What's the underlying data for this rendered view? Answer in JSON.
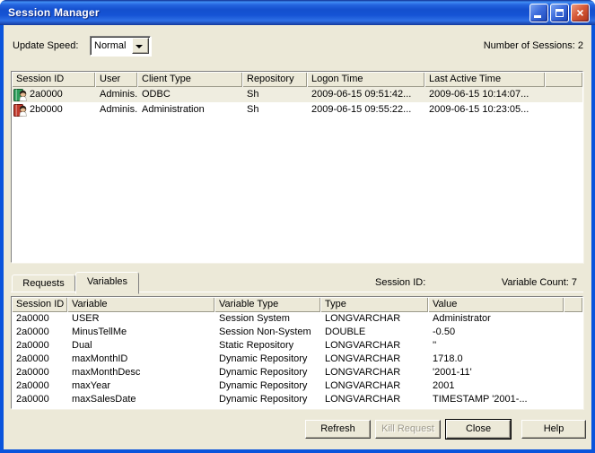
{
  "window": {
    "title": "Session Manager"
  },
  "titlebar": {
    "icons": [
      "minimize-icon",
      "maximize-icon",
      "close-icon"
    ],
    "close_glyph": "×"
  },
  "toolbar": {
    "update_speed_label": "Update Speed:",
    "update_speed_value": "Normal",
    "sessions_count_label": "Number of Sessions: 2"
  },
  "sessions_table": {
    "columns": [
      "Session ID",
      "User",
      "Client Type",
      "Repository",
      "Logon Time",
      "Last Active Time"
    ],
    "rows": [
      {
        "icon": "session-green-icon",
        "session_id": "2a0000",
        "user": "Adminis...",
        "client_type": "ODBC",
        "repository": "Sh",
        "logon_time": "2009-06-15 09:51:42...",
        "last_active": "2009-06-15 10:14:07...",
        "selected": true
      },
      {
        "icon": "session-red-icon",
        "session_id": "2b0000",
        "user": "Adminis...",
        "client_type": "Administration",
        "repository": "Sh",
        "logon_time": "2009-06-15 09:55:22...",
        "last_active": "2009-06-15 10:23:05...",
        "selected": false
      }
    ]
  },
  "tabs": {
    "requests_label": "Requests",
    "variables_label": "Variables",
    "active_tab": "Variables",
    "session_id_label": "Session ID:",
    "variable_count_label": "Variable Count: 7"
  },
  "variables_table": {
    "columns": [
      "Session ID",
      "Variable",
      "Variable Type",
      "Type",
      "Value"
    ],
    "rows": [
      [
        "2a0000",
        "USER",
        "Session System",
        "LONGVARCHAR",
        "Administrator"
      ],
      [
        "2a0000",
        "MinusTellMe",
        "Session Non-System",
        "DOUBLE",
        "-0.50"
      ],
      [
        "2a0000",
        "Dual",
        "Static Repository",
        "LONGVARCHAR",
        "''"
      ],
      [
        "2a0000",
        "maxMonthID",
        "Dynamic Repository",
        "LONGVARCHAR",
        "1718.0"
      ],
      [
        "2a0000",
        "maxMonthDesc",
        "Dynamic Repository",
        "LONGVARCHAR",
        "'2001-11'"
      ],
      [
        "2a0000",
        "maxYear",
        "Dynamic Repository",
        "LONGVARCHAR",
        "2001"
      ],
      [
        "2a0000",
        "maxSalesDate",
        "Dynamic Repository",
        "LONGVARCHAR",
        "TIMESTAMP '2001-..."
      ]
    ]
  },
  "footer_buttons": {
    "refresh": "Refresh",
    "kill_request": "Kill Request",
    "close": "Close",
    "help": "Help"
  },
  "colors": {
    "titlebar_blue": "#1553D4",
    "frame_blue": "#0A54DC",
    "face": "#ECE9D8",
    "selected_row": "#EFEDE0",
    "close_button_red": "#D75A38",
    "disabled_text": "#9D9A8B"
  }
}
